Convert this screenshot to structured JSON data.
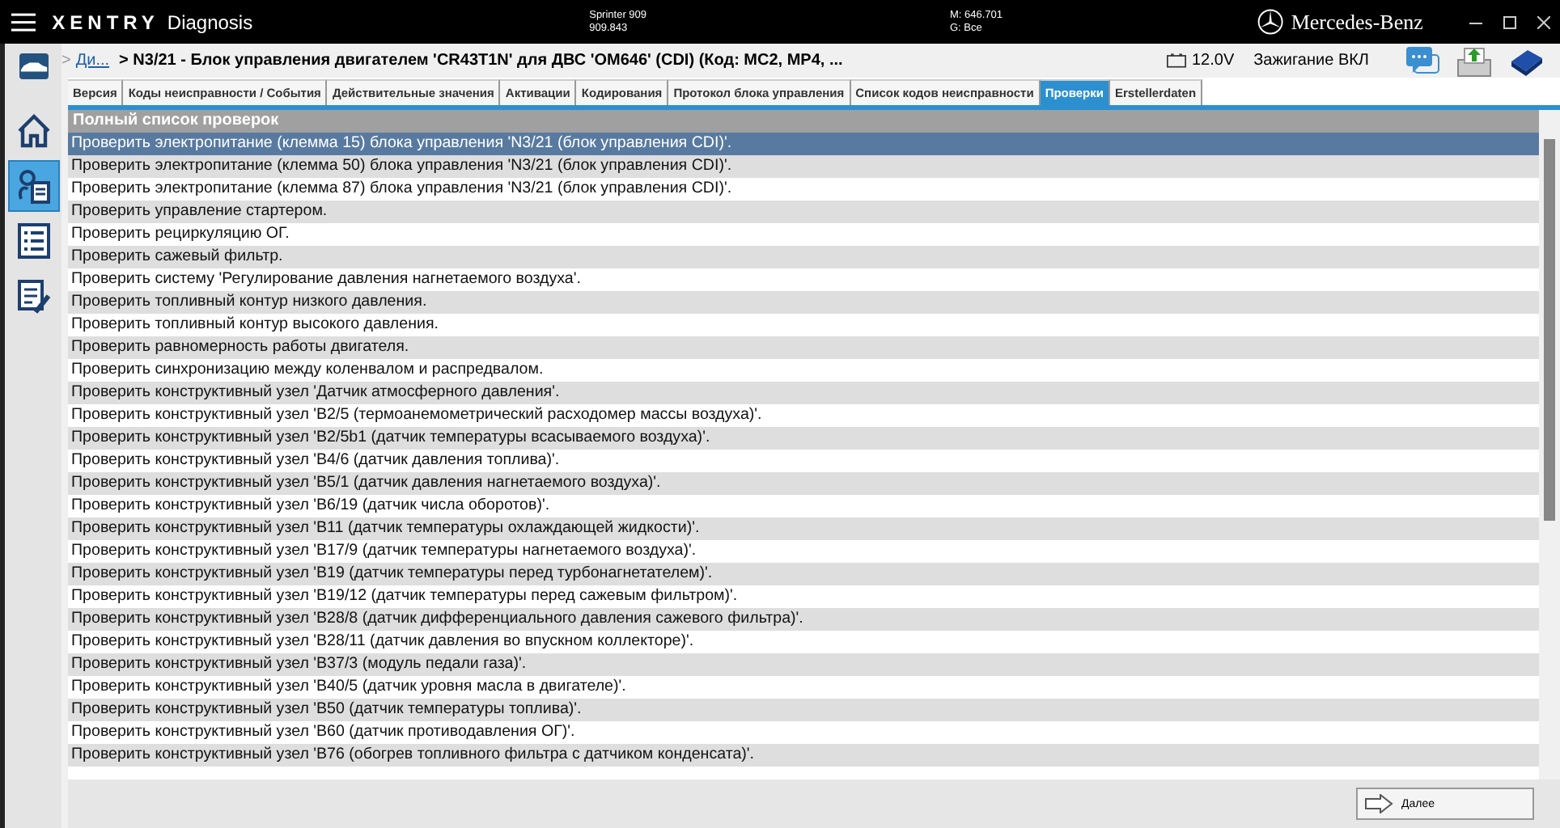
{
  "title_bar": {
    "brand": "XENTRY",
    "app": "Diagnosis",
    "vehicle_line_1": "Sprinter 909",
    "vehicle_line_2": "909.843",
    "model_line_1": "M: 646.701",
    "model_line_2": "G: Все",
    "maker": "Mercedes-Benz"
  },
  "header": {
    "breadcrumb_link": "Ди...",
    "breadcrumb_sep": ">",
    "title": "> N3/21 - Блок управления двигателем 'CR43T1N' для ДВС 'OM646' (CDI) (Код: MC2, MP4, ...",
    "voltage": "12.0V",
    "ignition": "Зажигание ВКЛ"
  },
  "sidebar": {
    "items": [
      {
        "kind": "home",
        "selected": false
      },
      {
        "kind": "diagnosis",
        "selected": true
      },
      {
        "kind": "list",
        "selected": false
      },
      {
        "kind": "tools",
        "selected": false
      }
    ]
  },
  "tabs": [
    {
      "label": "Версия",
      "selected": false
    },
    {
      "label": "Коды неисправности / События",
      "selected": false
    },
    {
      "label": "Действительные значения",
      "selected": false
    },
    {
      "label": "Активации",
      "selected": false
    },
    {
      "label": "Кодирования",
      "selected": false
    },
    {
      "label": "Протокол блока управления",
      "selected": false
    },
    {
      "label": "Список кодов неисправности",
      "selected": false
    },
    {
      "label": "Проверки",
      "selected": true
    },
    {
      "label": "Erstellerdaten",
      "selected": false
    }
  ],
  "list": {
    "heading": "Полный список проверок",
    "rows": [
      {
        "text": "Проверить электропитание (клемма 15) блока управления 'N3/21 (блок управления CDI)'.",
        "selected": true
      },
      {
        "text": "Проверить электропитание (клемма 50) блока управления 'N3/21 (блок управления CDI)'.",
        "selected": false
      },
      {
        "text": "Проверить электропитание (клемма 87) блока управления 'N3/21 (блок управления CDI)'.",
        "selected": false
      },
      {
        "text": "Проверить управление стартером.",
        "selected": false
      },
      {
        "text": "Проверить рециркуляцию ОГ.",
        "selected": false
      },
      {
        "text": "Проверить сажевый фильтр.",
        "selected": false
      },
      {
        "text": "Проверить систему 'Регулирование давления нагнетаемого воздуха'.",
        "selected": false
      },
      {
        "text": "Проверить топливный контур низкого давления.",
        "selected": false
      },
      {
        "text": "Проверить топливный контур высокого давления.",
        "selected": false
      },
      {
        "text": "Проверить равномерность работы двигателя.",
        "selected": false
      },
      {
        "text": "Проверить синхронизацию между коленвалом и распредвалом.",
        "selected": false
      },
      {
        "text": "Проверить конструктивный узел 'Датчик атмосферного давления'.",
        "selected": false
      },
      {
        "text": "Проверить конструктивный узел 'B2/5 (термоанемометрический расходомер массы воздуха)'.",
        "selected": false
      },
      {
        "text": "Проверить конструктивный узел 'B2/5b1 (датчик температуры всасываемого воздуха)'.",
        "selected": false
      },
      {
        "text": "Проверить конструктивный узел 'B4/6 (датчик давления топлива)'.",
        "selected": false
      },
      {
        "text": "Проверить конструктивный узел 'B5/1 (датчик давления нагнетаемого воздуха)'.",
        "selected": false
      },
      {
        "text": "Проверить конструктивный узел 'B6/19 (датчик числа оборотов)'.",
        "selected": false
      },
      {
        "text": "Проверить конструктивный узел 'B11 (датчик температуры охлаждающей жидкости)'.",
        "selected": false
      },
      {
        "text": "Проверить конструктивный узел 'B17/9 (датчик температуры нагнетаемого воздуха)'.",
        "selected": false
      },
      {
        "text": "Проверить конструктивный узел 'B19 (датчик температуры перед турбонагнетателем)'.",
        "selected": false
      },
      {
        "text": "Проверить конструктивный узел 'B19/12 (датчик температуры перед сажевым фильтром)'.",
        "selected": false
      },
      {
        "text": "Проверить конструктивный узел 'B28/8 (датчик дифференциального давления сажевого фильтра)'.",
        "selected": false
      },
      {
        "text": "Проверить конструктивный узел 'B28/11 (датчик давления во впускном коллекторе)'.",
        "selected": false
      },
      {
        "text": "Проверить конструктивный узел 'B37/3 (модуль педали газа)'.",
        "selected": false
      },
      {
        "text": "Проверить конструктивный узел 'B40/5 (датчик уровня масла в двигателе)'.",
        "selected": false
      },
      {
        "text": "Проверить конструктивный узел 'B50 (датчик температуры топлива)'.",
        "selected": false
      },
      {
        "text": "Проверить конструктивный узел 'B60 (датчик противодавления ОГ)'.",
        "selected": false
      },
      {
        "text": "Проверить конструктивный узел 'B76 (обогрев топливного фильтра с датчиком конденсата)'.",
        "selected": false
      }
    ]
  },
  "next_button": "Далее"
}
